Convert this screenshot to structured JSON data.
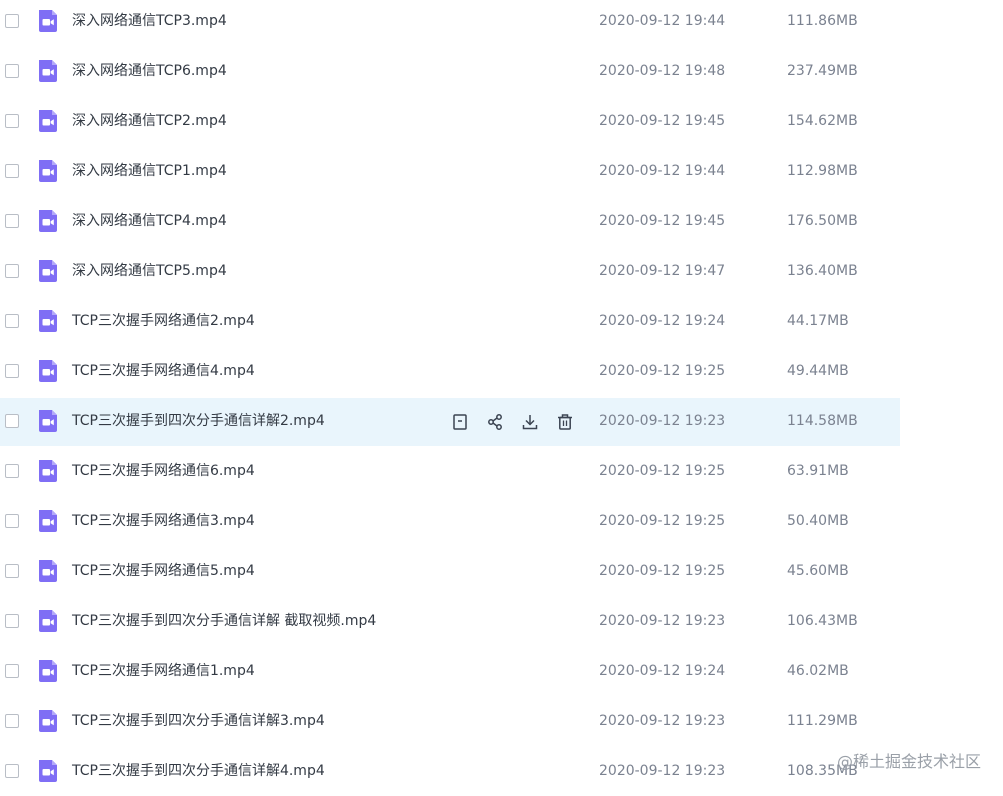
{
  "theme": {
    "icon_color": "#7f6ef5",
    "hover_bg": "#e9f5fc",
    "action_icon_color": "#3b4452"
  },
  "files": [
    {
      "name": "深入网络通信TCP3.mp4",
      "date": "2020-09-12 19:44",
      "size": "111.86MB",
      "icon": "video-file-icon"
    },
    {
      "name": "深入网络通信TCP6.mp4",
      "date": "2020-09-12 19:48",
      "size": "237.49MB",
      "icon": "video-file-icon"
    },
    {
      "name": "深入网络通信TCP2.mp4",
      "date": "2020-09-12 19:45",
      "size": "154.62MB",
      "icon": "video-file-icon"
    },
    {
      "name": "深入网络通信TCP1.mp4",
      "date": "2020-09-12 19:44",
      "size": "112.98MB",
      "icon": "video-file-icon"
    },
    {
      "name": "深入网络通信TCP4.mp4",
      "date": "2020-09-12 19:45",
      "size": "176.50MB",
      "icon": "video-file-icon"
    },
    {
      "name": "深入网络通信TCP5.mp4",
      "date": "2020-09-12 19:47",
      "size": "136.40MB",
      "icon": "video-file-icon"
    },
    {
      "name": "TCP三次握手网络通信2.mp4",
      "date": "2020-09-12 19:24",
      "size": "44.17MB",
      "icon": "video-file-icon"
    },
    {
      "name": "TCP三次握手网络通信4.mp4",
      "date": "2020-09-12 19:25",
      "size": "49.44MB",
      "icon": "video-file-icon"
    },
    {
      "name": "TCP三次握手到四次分手通信详解2.mp4",
      "date": "2020-09-12 19:23",
      "size": "114.58MB",
      "icon": "video-file-icon",
      "hovered": true
    },
    {
      "name": "TCP三次握手网络通信6.mp4",
      "date": "2020-09-12 19:25",
      "size": "63.91MB",
      "icon": "video-file-icon"
    },
    {
      "name": "TCP三次握手网络通信3.mp4",
      "date": "2020-09-12 19:25",
      "size": "50.40MB",
      "icon": "video-file-icon"
    },
    {
      "name": "TCP三次握手网络通信5.mp4",
      "date": "2020-09-12 19:25",
      "size": "45.60MB",
      "icon": "video-file-icon"
    },
    {
      "name": "TCP三次握手到四次分手通信详解 截取视频.mp4",
      "date": "2020-09-12 19:23",
      "size": "106.43MB",
      "icon": "video-file-icon"
    },
    {
      "name": "TCP三次握手网络通信1.mp4",
      "date": "2020-09-12 19:24",
      "size": "46.02MB",
      "icon": "video-file-icon"
    },
    {
      "name": "TCP三次握手到四次分手通信详解3.mp4",
      "date": "2020-09-12 19:23",
      "size": "111.29MB",
      "icon": "video-file-icon"
    },
    {
      "name": "TCP三次握手到四次分手通信详解4.mp4",
      "date": "2020-09-12 19:23",
      "size": "108.35MB",
      "icon": "video-file-icon"
    }
  ],
  "row_actions": [
    {
      "name": "detail-button",
      "icon": "document-icon"
    },
    {
      "name": "share-button",
      "icon": "share-icon"
    },
    {
      "name": "download-button",
      "icon": "download-icon"
    },
    {
      "name": "delete-button",
      "icon": "trash-icon"
    }
  ],
  "watermark": "@稀土掘金技术社区"
}
